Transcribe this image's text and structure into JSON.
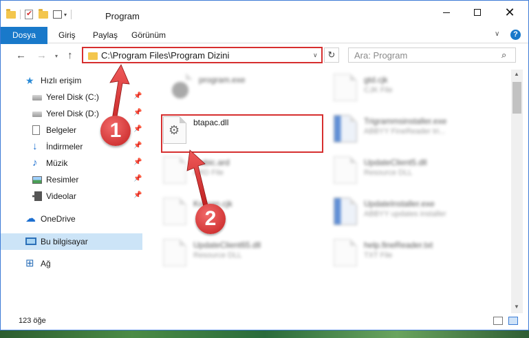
{
  "window": {
    "title": "Program",
    "colors": {
      "accent": "#1979ca",
      "highlight": "#d62e2e",
      "selection": "#cce4f7"
    }
  },
  "ribbon": {
    "tabs": [
      {
        "label": "Dosya"
      },
      {
        "label": "Giriş"
      },
      {
        "label": "Paylaş"
      },
      {
        "label": "Görünüm"
      }
    ],
    "help_label": "?"
  },
  "address": {
    "path": "C:\\Program Files\\Program Dizini",
    "search_placeholder": "Ara: Program"
  },
  "nav": {
    "items": [
      {
        "label": "Hızlı erişim",
        "icon": "star-icon"
      },
      {
        "label": "Yerel Disk (C:)",
        "icon": "disk-icon",
        "pinned": true
      },
      {
        "label": "Yerel Disk (D:)",
        "icon": "disk-icon",
        "pinned": true
      },
      {
        "label": "Belgeler",
        "icon": "documents-icon",
        "pinned": true
      },
      {
        "label": "İndirmeler",
        "icon": "download-icon",
        "pinned": true
      },
      {
        "label": "Müzik",
        "icon": "music-icon",
        "pinned": true
      },
      {
        "label": "Resimler",
        "icon": "pictures-icon",
        "pinned": true
      },
      {
        "label": "Videolar",
        "icon": "videos-icon",
        "pinned": true
      },
      {
        "label": "OneDrive",
        "icon": "cloud-icon"
      },
      {
        "label": "Bu bilgisayar",
        "icon": "computer-icon",
        "selected": true
      },
      {
        "label": "Ağ",
        "icon": "network-icon"
      }
    ]
  },
  "files": [
    {
      "name": "program.exe",
      "type": ""
    },
    {
      "name": "gtd.cjk",
      "type": "CJK File"
    },
    {
      "name": "btapac.dll",
      "type": ""
    },
    {
      "name": "Trigrammsinstaller.exe",
      "type": "ABBYY FineReader tri..."
    },
    {
      "name": "...abic.ard",
      "type": "ARD File"
    },
    {
      "name": "UpdateClient5.dll",
      "type": "Resource DLL"
    },
    {
      "name": "Korean.cjk",
      "type": ""
    },
    {
      "name": "UpdateInstaller.exe",
      "type": "ABBYY updates installer"
    },
    {
      "name": "UpdateClient65.dll",
      "type": "Resource DLL"
    },
    {
      "name": "help.fineReader.txt",
      "type": "TXT File"
    }
  ],
  "annotations": {
    "step1": "1",
    "step2": "2"
  },
  "status": {
    "count": "123 öğe"
  }
}
